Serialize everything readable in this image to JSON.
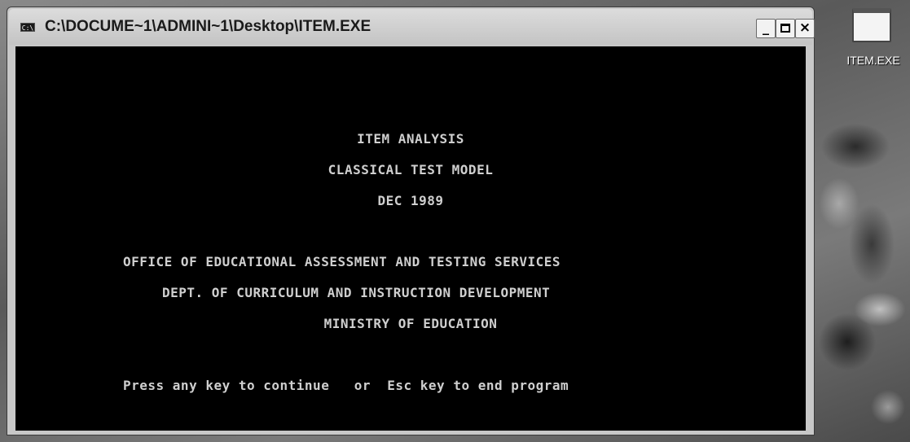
{
  "window": {
    "title": "C:\\DOCUME~1\\ADMINI~1\\Desktop\\ITEM.EXE",
    "app_icon": "cmd-icon",
    "app_icon_text": "C:\\",
    "minimize_glyph": "_",
    "close_glyph": "×"
  },
  "console": {
    "lines": [
      "ITEM ANALYSIS",
      "CLASSICAL TEST MODEL",
      "DEC 1989",
      "OFFICE OF EDUCATIONAL ASSESSMENT AND TESTING SERVICES",
      "DEPT. OF CURRICULUM AND INSTRUCTION DEVELOPMENT",
      "MINISTRY OF EDUCATION",
      "Press any key to continue   or  Esc key to end program"
    ],
    "background_color": "#000000",
    "text_color": "#cfcfcf"
  },
  "desktop": {
    "icon_label": "ITEM.EXE",
    "icon": "window-icon"
  }
}
